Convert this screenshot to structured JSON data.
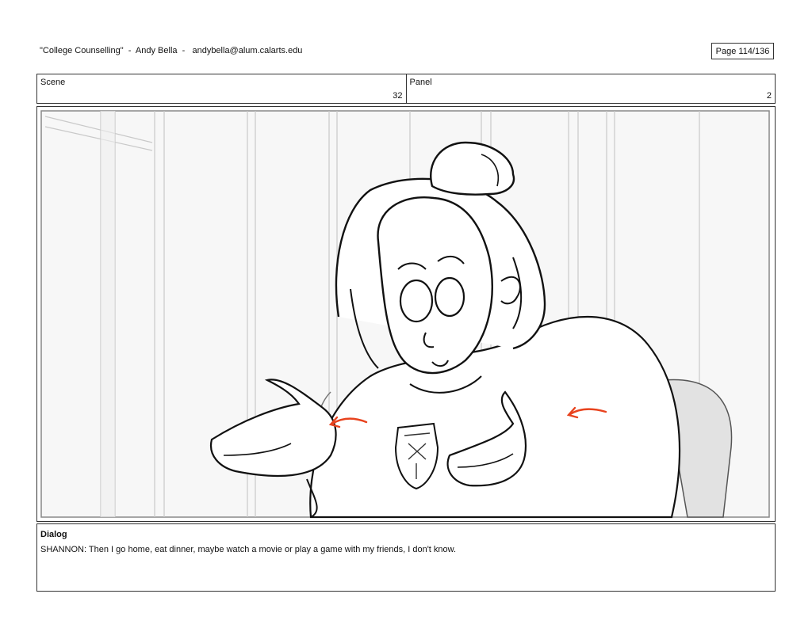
{
  "header": {
    "title": "\"College Counselling\"  -  Andy Bella  -   andybella@alum.calarts.edu",
    "page": "Page 114/136"
  },
  "meta": {
    "scene_label": "Scene",
    "scene_value": "32",
    "panel_label": "Panel",
    "panel_value": "2"
  },
  "dialog": {
    "label": "Dialog",
    "text": "SHANNON: Then I go home, eat dinner, maybe watch a movie or play a game with my friends, I don't know."
  },
  "colors": {
    "border": "#333333",
    "sketch_line": "#111111",
    "accent_arrow": "#e8431e"
  }
}
